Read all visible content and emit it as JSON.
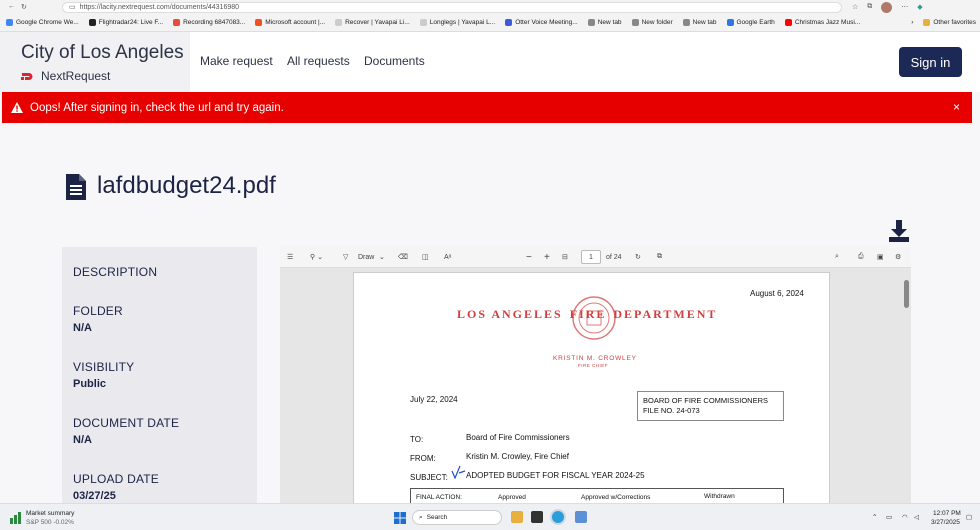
{
  "browser": {
    "url": "https://lacity.nextrequest.com/documents/44316980",
    "favorites": [
      {
        "label": "Google Chrome We...",
        "color": "#4285f4"
      },
      {
        "label": "Flightradar24: Live F...",
        "color": "#222222"
      },
      {
        "label": "Recording 6847083...",
        "color": "#e74c3c"
      },
      {
        "label": "Microsoft account |...",
        "color": "#f25022"
      },
      {
        "label": "Recover | Yavapai Li...",
        "color": "#cccccc"
      },
      {
        "label": "Longlegs | Yavapai L...",
        "color": "#cccccc"
      },
      {
        "label": "Otter Voice Meeting...",
        "color": "#3b5bdb"
      },
      {
        "label": "New tab",
        "color": "#888888"
      },
      {
        "label": "New folder",
        "color": "#888888"
      },
      {
        "label": "New tab",
        "color": "#888888"
      },
      {
        "label": "Google Earth",
        "color": "#2a7ae2"
      },
      {
        "label": "Christmas Jazz Musi...",
        "color": "#ff0000"
      }
    ],
    "other_favorites": "Other favorites"
  },
  "header": {
    "site_title": "City of Los Angeles",
    "logo_text": "NextRequest",
    "nav": [
      "Make request",
      "All requests",
      "Documents"
    ],
    "sign_in": "Sign in"
  },
  "alert": {
    "message": "Oops! After signing in, check the url and try again.",
    "close": "×"
  },
  "document": {
    "title": "lafdbudget24.pdf"
  },
  "sidebar": {
    "fields": [
      {
        "label": "DESCRIPTION",
        "value": ""
      },
      {
        "label": "FOLDER",
        "value": "N/A"
      },
      {
        "label": "VISIBILITY",
        "value": "Public"
      },
      {
        "label": "DOCUMENT DATE",
        "value": "N/A"
      },
      {
        "label": "UPLOAD DATE",
        "value": "03/27/25"
      }
    ]
  },
  "pdf_toolbar": {
    "draw": "Draw",
    "page_current": "1",
    "page_total": "of 24"
  },
  "pdf_page": {
    "date_top": "August 6, 2024",
    "letterhead_left": "LOS ANGELES",
    "letterhead_fire": "FIRE",
    "letterhead_right": "DEPARTMENT",
    "chief_name": "KRISTIN M. CROWLEY",
    "chief_title": "FIRE CHIEF",
    "date": "July 22, 2024",
    "board_box_line1": "BOARD OF FIRE COMMISSIONERS",
    "board_box_line2": "FILE NO.  24-073",
    "to_label": "TO:",
    "to_value": "Board of Fire Commissioners",
    "from_label": "FROM:",
    "from_value": "Kristin M. Crowley, Fire Chief",
    "subject_label": "SUBJECT:",
    "subject_value": "ADOPTED BUDGET FOR FISCAL YEAR 2024-25",
    "final_action": "FINAL ACTION:",
    "opt_approved": "Approved",
    "opt_approved_corr": "Approved w/Corrections",
    "opt_withdrawn": "Withdrawn"
  },
  "taskbar": {
    "widget_title": "Market summary",
    "widget_sub": "S&P 500 -0.02%",
    "search": "Search",
    "time": "12:07 PM",
    "date": "3/27/2025"
  }
}
